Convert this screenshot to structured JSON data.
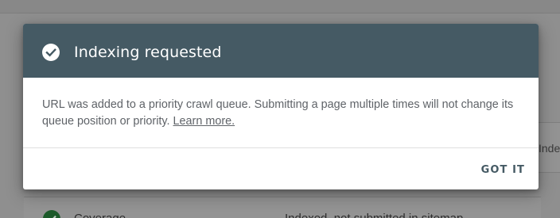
{
  "background": {
    "right_card_text": "Indexing",
    "row_label": "Coverage",
    "row_value": "Indexed, not submitted in sitemap"
  },
  "dialog": {
    "title": "Indexing requested",
    "icon": "check-circle-icon",
    "message": "URL was added to a priority crawl queue. Submitting a page multiple times will not change its queue position or priority.",
    "link_text": "Learn more.",
    "confirm_label": "GOT IT"
  },
  "colors": {
    "header_bg": "#455a64",
    "scrim": "#8f8f8f",
    "body_text": "#5f6368",
    "status_ok": "#1c5a2a"
  }
}
